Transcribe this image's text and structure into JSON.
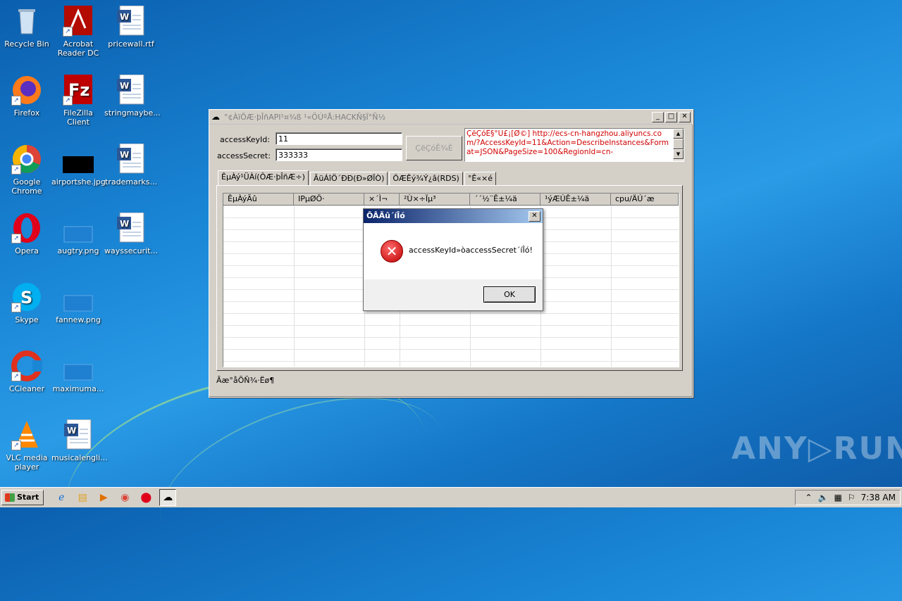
{
  "desktop": {
    "icons": [
      {
        "label": "Recycle Bin"
      },
      {
        "label": "Acrobat Reader DC"
      },
      {
        "label": "pricewall.rtf"
      },
      {
        "label": "Firefox"
      },
      {
        "label": "FileZilla Client"
      },
      {
        "label": "stringmaybe..."
      },
      {
        "label": "Google Chrome"
      },
      {
        "label": "airportshe.jpg"
      },
      {
        "label": "trademarks..."
      },
      {
        "label": "Opera"
      },
      {
        "label": "augtry.png"
      },
      {
        "label": "wayssecurit..."
      },
      {
        "label": "Skype"
      },
      {
        "label": "fannew.png"
      },
      {
        "label": "CCleaner"
      },
      {
        "label": "maximuma..."
      },
      {
        "label": "VLC media player"
      },
      {
        "label": "musicalengli..."
      }
    ],
    "watermark": "ANY▷RUN"
  },
  "window": {
    "title": "°¢ÀïÔÆ·þÎñAPI¹¤¾ß ¹«ÖÚºÅ:HACKÑ§Ï°Ñ½",
    "access_key_label": "accessKeyId:",
    "access_key_value": "11",
    "access_secret_label": "accessSecret:",
    "access_secret_value": "333333",
    "query_button": "ÇëÇóÊ¾È",
    "url_text": "ÇëÇóÊ§°Ü£¡[Ø©] http://ecs-cn-hangzhou.aliyuncs.com/?AccessKeyId=11&Action=DescribeInstances&Format=JSON&PageSize=100&RegionId=cn-",
    "tabs": [
      "ÊµÀý¹ÜÀí(ÔÆ·þÎñÆ÷)",
      "ÃüÁîÖ´ÐÐ(Ð»ØÎÒ)",
      "ÔÆÊý¾Ý¿â(RDS)",
      "°Ê«×é"
    ],
    "columns": [
      "ÊµÀýÃû",
      "IPµØÖ·",
      "×´Ì¬",
      "²Ù×÷Ïµ³",
      "´´½¨Ê±¼ä",
      "¹ýÆÚÊ±¼ä",
      "cpu/ÄÚ´æ"
    ],
    "status": "Ãæ°åÕÑ¾·Ëø¶"
  },
  "dialog": {
    "title": "ÕÂÃû´íÎó",
    "message": "accessKeyId»òaccessSecret´íÎó!",
    "ok": "OK"
  },
  "taskbar": {
    "start": "Start",
    "clock": "7:38 AM"
  }
}
